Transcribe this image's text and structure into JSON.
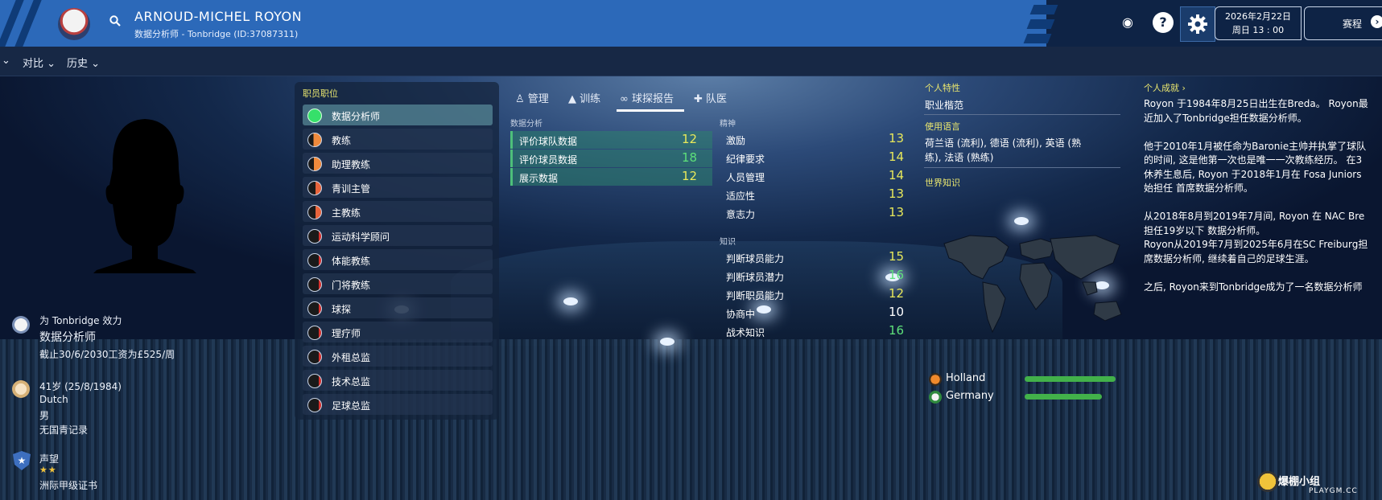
{
  "header": {
    "name": "ARNOUD-MICHEL ROYON",
    "subtitle": "数据分析师 - Tonbridge (ID:37087311)",
    "date_line1": "2026年2月22日",
    "date_line2": "周日 13 : 00",
    "schedule_label": "赛程",
    "help_label": "?"
  },
  "subnav": {
    "compare": "对比",
    "history": "历史"
  },
  "left": {
    "club_line": "为 Tonbridge 效力",
    "role": "数据分析师",
    "contract": "截止30/6/2030工资为£525/周",
    "age": "41岁 (25/8/1984)",
    "nationality": "Dutch",
    "gender": "男",
    "youth_record": "无国青记录",
    "reputation_label": "声望",
    "reputation_stars": 2,
    "license": "洲际甲级证书"
  },
  "positions": {
    "title": "职员职位",
    "items": [
      {
        "label": "数据分析师",
        "level": 1.0,
        "selected": true
      },
      {
        "label": "教练",
        "level": 0.6
      },
      {
        "label": "助理教练",
        "level": 0.55
      },
      {
        "label": "青训主管",
        "level": 0.45
      },
      {
        "label": "主教练",
        "level": 0.45
      },
      {
        "label": "运动科学顾问",
        "level": 0.2
      },
      {
        "label": "体能教练",
        "level": 0.2
      },
      {
        "label": "门将教练",
        "level": 0.2
      },
      {
        "label": "球探",
        "level": 0.2
      },
      {
        "label": "理疗师",
        "level": 0.2
      },
      {
        "label": "外租总监",
        "level": 0.2
      },
      {
        "label": "技术总监",
        "level": 0.2
      },
      {
        "label": "足球总监",
        "level": 0.2
      }
    ]
  },
  "tabs": [
    {
      "label": "管理"
    },
    {
      "label": "训练"
    },
    {
      "label": "球探报告",
      "active": true
    },
    {
      "label": "队医"
    }
  ],
  "analysis": {
    "title": "数据分析",
    "rows": [
      {
        "label": "评价球队数据",
        "value": "12"
      },
      {
        "label": "评价球员数据",
        "value": "18"
      },
      {
        "label": "展示数据",
        "value": "12"
      }
    ]
  },
  "mental": {
    "title": "精神",
    "rows": [
      {
        "label": "激励",
        "value": "13"
      },
      {
        "label": "纪律要求",
        "value": "14"
      },
      {
        "label": "人员管理",
        "value": "14"
      },
      {
        "label": "适应性",
        "value": "13"
      },
      {
        "label": "意志力",
        "value": "13"
      }
    ]
  },
  "knowledge": {
    "title": "知识",
    "rows": [
      {
        "label": "判断球员能力",
        "value": "15"
      },
      {
        "label": "判断球员潜力",
        "value": "16"
      },
      {
        "label": "判断职员能力",
        "value": "12"
      },
      {
        "label": "协商中",
        "value": "10"
      },
      {
        "label": "战术知识",
        "value": "16"
      }
    ]
  },
  "personal": {
    "traits_title": "个人特性",
    "trait": "职业楷范",
    "lang_title": "使用语言",
    "languages_l1": "荷兰语 (流利), 德语 (流利), 英语 (熟",
    "languages_l2": "练), 法语 (熟练)",
    "world_title": "世界知识",
    "countries": [
      {
        "name": "Holland",
        "level": 1.0
      },
      {
        "name": "Germany",
        "level": 0.85
      }
    ]
  },
  "achievements": {
    "title": "个人成就",
    "arrow": "›",
    "lines": [
      "Royon 于1984年8月25日出生在Breda。 Royon最",
      "近加入了Tonbridge担任数据分析师。",
      "",
      "他于2010年1月被任命为Baronie主帅并执掌了球队",
      "的时间, 这是他第一次也是唯一一次教练经历。 在3",
      "休养生息后, Royon 于2018年1月在 Fosa Juniors",
      "始担任 首席数据分析师。",
      "",
      "从2018年8月到2019年7月间, Royon 在 NAC Bre",
      "担任19岁以下 数据分析师。",
      "Royon从2019年7月到2025年6月在SC Freiburg担",
      "席数据分析师, 继续着自己的足球生涯。",
      "",
      "之后, Royon来到Tonbridge成为了一名数据分析师"
    ]
  },
  "watermark": {
    "cn": "爆棚小组",
    "en": "PLAYGM.CC"
  },
  "colors": {
    "topbar": "#2c69b9",
    "value_yellow": "#e8e85a",
    "value_green": "#5ee07a",
    "value_white": "#ffffff"
  }
}
